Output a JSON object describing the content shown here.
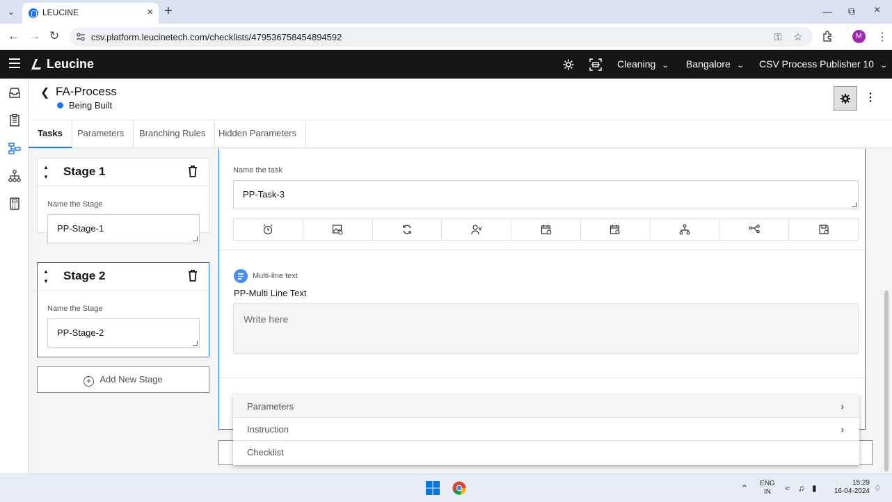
{
  "browser": {
    "tab_title": "LEUCINE",
    "url": "csv.platform.leucinetech.com/checklists/479536758454894592",
    "profile_initial": "M"
  },
  "header": {
    "logo_text": "Leucine",
    "use_case": "Cleaning",
    "facility": "Bangalore",
    "user": "CSV Process Publisher 10"
  },
  "page": {
    "title": "FA-Process",
    "status": "Being Built",
    "status_color": "#1d74f5"
  },
  "tabs": [
    {
      "label": "Tasks",
      "active": true
    },
    {
      "label": "Parameters"
    },
    {
      "label": "Branching Rules"
    },
    {
      "label": "Hidden Parameters"
    }
  ],
  "stages": [
    {
      "title": "Stage 1",
      "field_label": "Name the Stage",
      "value": "PP-Stage-1"
    },
    {
      "title": "Stage 2",
      "field_label": "Name the Stage",
      "value": "PP-Stage-2"
    }
  ],
  "add_stage_label": "Add New Stage",
  "task": {
    "field_label": "Name the task",
    "value": "PP-Task-3",
    "toolbar_icons": [
      "alarm-icon",
      "media-icon",
      "recurrence-icon",
      "assignee-icon",
      "schedule-icon",
      "calendar-icon",
      "hierarchy-icon",
      "branching-icon",
      "save-template-icon"
    ]
  },
  "parameter": {
    "type_label": "Multi-line text",
    "name": "PP-Multi Line Text",
    "placeholder": "Write here"
  },
  "add_menu": {
    "items": [
      {
        "label": "Parameters",
        "has_submenu": true
      },
      {
        "label": "Instruction",
        "has_submenu": true
      },
      {
        "label": "Checklist",
        "has_submenu": false
      }
    ]
  },
  "taskbar": {
    "lang": "ENG",
    "region": "IN",
    "time": "15:29",
    "date": "16-04-2024"
  }
}
